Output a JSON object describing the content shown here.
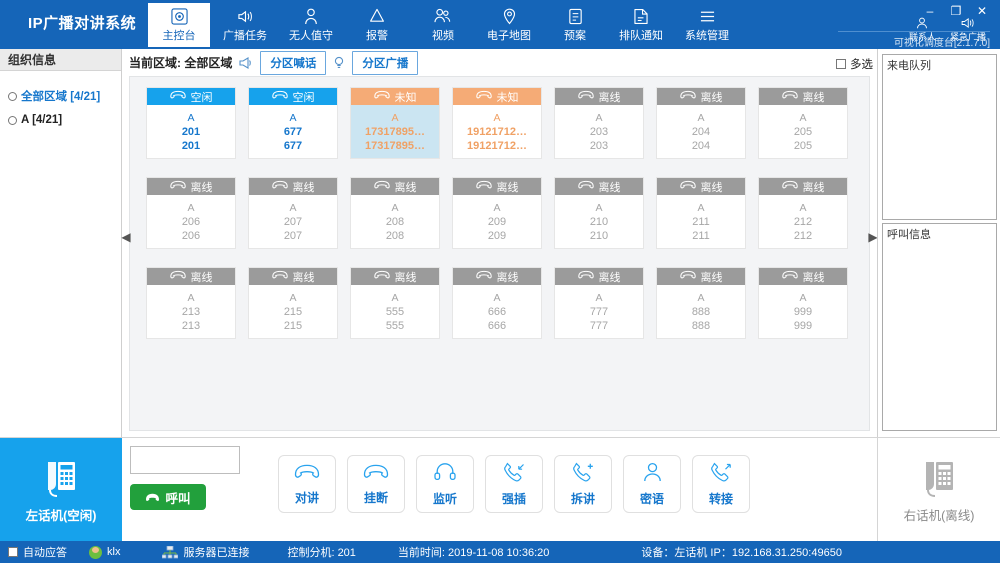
{
  "header": {
    "brand": "IP广播对讲系统",
    "nav": [
      {
        "label": "主控台",
        "icon": "console-icon",
        "active": true
      },
      {
        "label": "广播任务",
        "icon": "speaker-icon",
        "active": false
      },
      {
        "label": "无人值守",
        "icon": "person-icon",
        "active": false
      },
      {
        "label": "报警",
        "icon": "bell-icon",
        "active": false
      },
      {
        "label": "视频",
        "icon": "video-icon",
        "active": false
      },
      {
        "label": "电子地图",
        "icon": "map-pin-icon",
        "active": false
      },
      {
        "label": "预案",
        "icon": "plan-icon",
        "active": false
      },
      {
        "label": "排队通知",
        "icon": "queue-notice-icon",
        "active": false
      },
      {
        "label": "系统管理",
        "icon": "menu-icon",
        "active": false
      }
    ],
    "quick": [
      {
        "label": "联系人",
        "icon": "contacts-icon"
      },
      {
        "label": "紧急广播",
        "icon": "emergency-broadcast-icon"
      }
    ],
    "version": "可视化调度台[2.1.7.0]",
    "window_buttons": {
      "minimize": "–",
      "maximize": "❐",
      "close": "✕"
    },
    "accent": "#1565b8"
  },
  "sidebar": {
    "title": "组织信息",
    "nodes": [
      {
        "label": "全部区域 [4/21]",
        "selected": true
      },
      {
        "label": "A [4/21]",
        "selected": false
      }
    ]
  },
  "toolbar": {
    "current_area": "当前区域: 全部区域",
    "zone_talk_button": "分区喊话",
    "zone_broadcast_button": "分区广播",
    "multiselect_label": "多选",
    "megaphone_icon": "megaphone-icon",
    "bulb_icon": "bulb-icon"
  },
  "right_panel": {
    "queue_title": "来电队列",
    "info_title": "呼叫信息"
  },
  "grid": {
    "prev_arrow": "◀",
    "next_arrow": "▶",
    "cards": [
      {
        "status": "空闲",
        "state": "idle",
        "name": "A",
        "num1": "201",
        "num2": "201",
        "selected": false
      },
      {
        "status": "空闲",
        "state": "idle",
        "name": "A",
        "num1": "677",
        "num2": "677",
        "selected": false
      },
      {
        "status": "未知",
        "state": "unknown",
        "name": "A",
        "num1": "17317895…",
        "num2": "17317895…",
        "selected": true
      },
      {
        "status": "未知",
        "state": "unknown",
        "name": "A",
        "num1": "19121712…",
        "num2": "19121712…",
        "selected": false
      },
      {
        "status": "离线",
        "state": "offline",
        "name": "A",
        "num1": "203",
        "num2": "203",
        "selected": false
      },
      {
        "status": "离线",
        "state": "offline",
        "name": "A",
        "num1": "204",
        "num2": "204",
        "selected": false
      },
      {
        "status": "离线",
        "state": "offline",
        "name": "A",
        "num1": "205",
        "num2": "205",
        "selected": false
      },
      {
        "status": "离线",
        "state": "offline",
        "name": "A",
        "num1": "206",
        "num2": "206",
        "selected": false
      },
      {
        "status": "离线",
        "state": "offline",
        "name": "A",
        "num1": "207",
        "num2": "207",
        "selected": false
      },
      {
        "status": "离线",
        "state": "offline",
        "name": "A",
        "num1": "208",
        "num2": "208",
        "selected": false
      },
      {
        "status": "离线",
        "state": "offline",
        "name": "A",
        "num1": "209",
        "num2": "209",
        "selected": false
      },
      {
        "status": "离线",
        "state": "offline",
        "name": "A",
        "num1": "210",
        "num2": "210",
        "selected": false
      },
      {
        "status": "离线",
        "state": "offline",
        "name": "A",
        "num1": "211",
        "num2": "211",
        "selected": false
      },
      {
        "status": "离线",
        "state": "offline",
        "name": "A",
        "num1": "212",
        "num2": "212",
        "selected": false
      },
      {
        "status": "离线",
        "state": "offline",
        "name": "A",
        "num1": "213",
        "num2": "213",
        "selected": false
      },
      {
        "status": "离线",
        "state": "offline",
        "name": "A",
        "num1": "215",
        "num2": "215",
        "selected": false
      },
      {
        "status": "离线",
        "state": "offline",
        "name": "A",
        "num1": "555",
        "num2": "555",
        "selected": false
      },
      {
        "status": "离线",
        "state": "offline",
        "name": "A",
        "num1": "666",
        "num2": "666",
        "selected": false
      },
      {
        "status": "离线",
        "state": "offline",
        "name": "A",
        "num1": "777",
        "num2": "777",
        "selected": false
      },
      {
        "status": "离线",
        "state": "offline",
        "name": "A",
        "num1": "888",
        "num2": "888",
        "selected": false
      },
      {
        "status": "离线",
        "state": "offline",
        "name": "A",
        "num1": "999",
        "num2": "999",
        "selected": false
      }
    ],
    "colors": {
      "idle": "#16a2ec",
      "unknown": "#f5ab76",
      "offline": "#9b9b9b",
      "selected_body": "#cbe5f2"
    }
  },
  "bottom": {
    "left_phone_label": "左话机(空闲)",
    "right_phone_label": "右话机(离线)",
    "dial_value": "",
    "dial_placeholder": "",
    "call_button": "呼叫",
    "actions": [
      {
        "label": "对讲",
        "icon": "handset-icon"
      },
      {
        "label": "挂断",
        "icon": "hangup-icon"
      },
      {
        "label": "监听",
        "icon": "headset-icon"
      },
      {
        "label": "强插",
        "icon": "call-incoming-icon"
      },
      {
        "label": "拆讲",
        "icon": "call-add-icon"
      },
      {
        "label": "密语",
        "icon": "user-icon"
      },
      {
        "label": "转接",
        "icon": "call-transfer-icon"
      }
    ]
  },
  "statusbar": {
    "auto_answer_label": "自动应答",
    "user_name": "klx",
    "server_status": "服务器已连接",
    "control_ext": "控制分机: 201",
    "current_time": "当前时间: 2019-11-08 10:36:20",
    "device_info": "设备：左话机  IP：192.168.31.250:49650"
  }
}
